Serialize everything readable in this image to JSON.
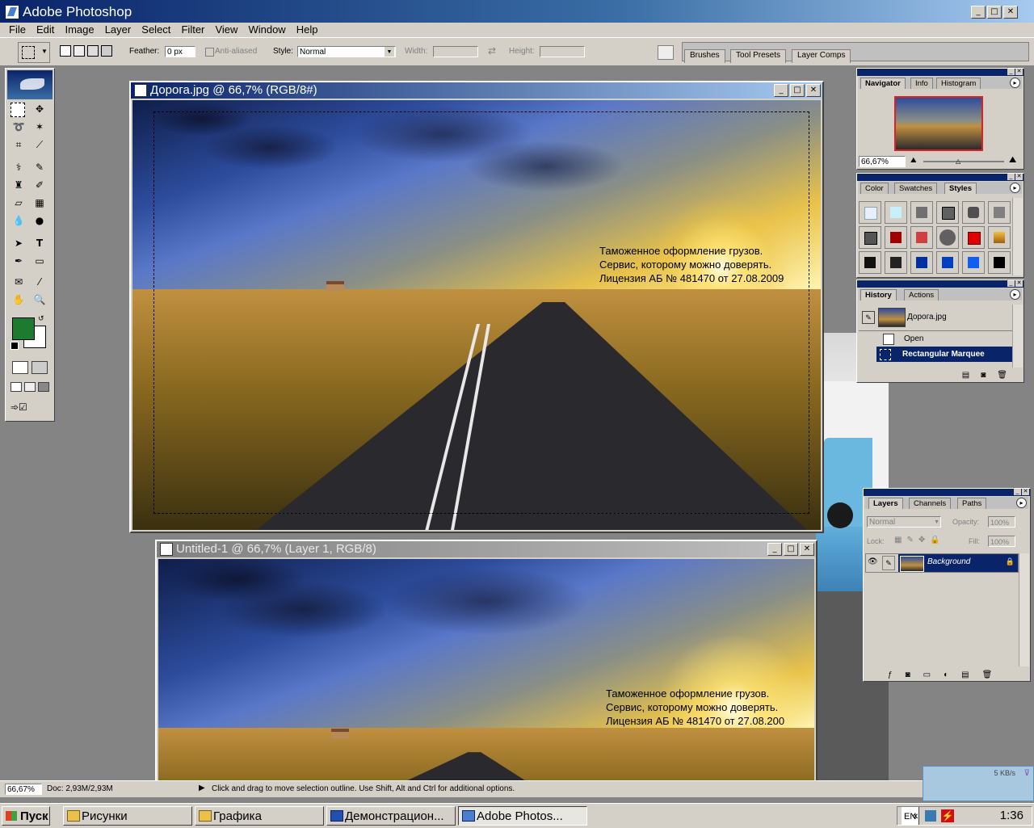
{
  "app": {
    "title": "Adobe Photoshop"
  },
  "menu": [
    "File",
    "Edit",
    "Image",
    "Layer",
    "Select",
    "Filter",
    "View",
    "Window",
    "Help"
  ],
  "options": {
    "feather_label": "Feather:",
    "feather_value": "0 px",
    "antialias_label": "Anti-aliased",
    "style_label": "Style:",
    "style_value": "Normal",
    "width_label": "Width:",
    "height_label": "Height:"
  },
  "well_tabs": [
    "Brushes",
    "Tool Presets",
    "Layer Comps"
  ],
  "doc1": {
    "title": "Дорога.jpg @ 66,7% (RGB/8#)",
    "text": "Таможенное оформление грузов.\nСервис, которому можно доверять.\nЛицензия АБ № 481470 от 27.08.2009"
  },
  "doc2": {
    "title": "Untitled-1 @ 66,7% (Layer 1, RGB/8)",
    "text": "Таможенное оформление грузов.\nСервис, которому можно доверять.\nЛицензия АБ № 481470 от 27.08.200"
  },
  "navigator": {
    "tabs": [
      "Navigator",
      "Info",
      "Histogram"
    ],
    "zoom": "66,67%"
  },
  "styles_panel": {
    "tabs": [
      "Color",
      "Swatches",
      "Styles"
    ]
  },
  "history": {
    "tabs": [
      "History",
      "Actions"
    ],
    "snapshot": "Дорога.jpg",
    "items": [
      "Open",
      "Rectangular Marquee"
    ]
  },
  "layers": {
    "tabs": [
      "Layers",
      "Channels",
      "Paths"
    ],
    "blend": "Normal",
    "opacity_label": "Opacity:",
    "opacity_value": "100%",
    "lock_label": "Lock:",
    "fill_label": "Fill:",
    "fill_value": "100%",
    "layer_name": "Background"
  },
  "status": {
    "zoom": "66,67%",
    "doc": "Doc: 2,93M/2,93M",
    "hint": "Click and drag to move selection outline.  Use Shift, Alt and Ctrl for additional options."
  },
  "net": {
    "speed": "5 KB/s"
  },
  "taskbar": {
    "start": "Пуск",
    "buttons": [
      "Рисунки",
      "Графика",
      "Демонстрацион...",
      "Adobe Photos..."
    ],
    "lang": "EN",
    "clock": "1:36"
  },
  "colors": {
    "foreground": "#1e7a2e",
    "background": "#ffffff",
    "title_active": "#0a246a"
  }
}
